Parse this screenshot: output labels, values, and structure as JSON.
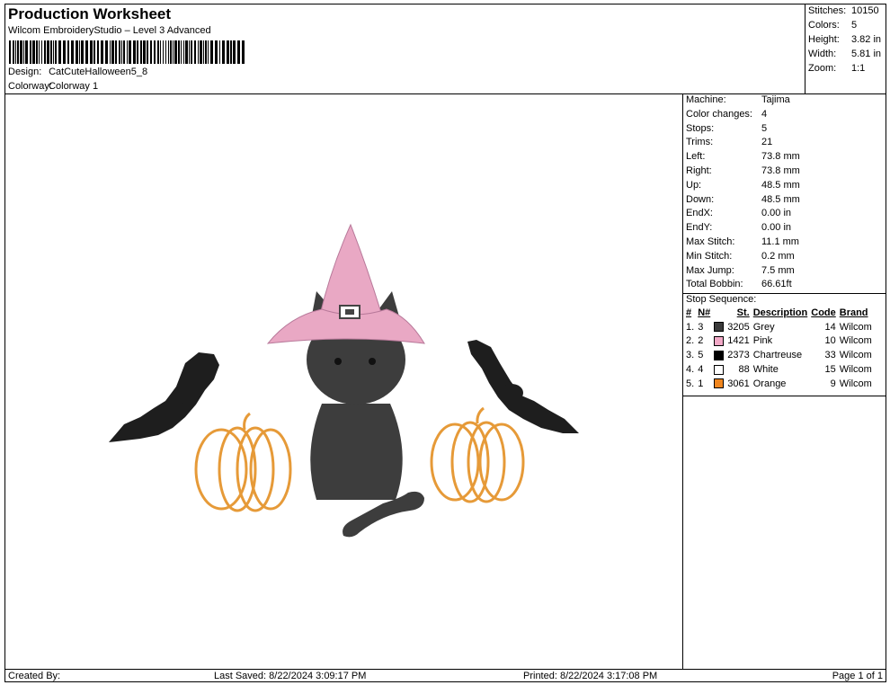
{
  "header": {
    "title": "Production Worksheet",
    "subtitle": "Wilcom EmbroideryStudio – Level 3 Advanced",
    "design_label": "Design:",
    "design_value": "CatCuteHalloween5_8",
    "colorway_label": "Colorway:",
    "colorway_value": "Colorway 1"
  },
  "stats": [
    {
      "label": "Stitches:",
      "value": "10150"
    },
    {
      "label": "Colors:",
      "value": "5"
    },
    {
      "label": "Height:",
      "value": "3.82 in"
    },
    {
      "label": "Width:",
      "value": "5.81 in"
    },
    {
      "label": "Zoom:",
      "value": "1:1"
    }
  ],
  "machine": [
    {
      "label": "Machine:",
      "value": "Tajima"
    },
    {
      "label": "Color changes:",
      "value": "4"
    },
    {
      "label": "Stops:",
      "value": "5"
    },
    {
      "label": "Trims:",
      "value": "21"
    },
    {
      "label": "Left:",
      "value": "73.8 mm"
    },
    {
      "label": "Right:",
      "value": "73.8 mm"
    },
    {
      "label": "Up:",
      "value": "48.5 mm"
    },
    {
      "label": "Down:",
      "value": "48.5 mm"
    },
    {
      "label": "EndX:",
      "value": "0.00 in"
    },
    {
      "label": "EndY:",
      "value": "0.00 in"
    },
    {
      "label": "Max Stitch:",
      "value": "11.1 mm"
    },
    {
      "label": "Min Stitch:",
      "value": "0.2 mm"
    },
    {
      "label": "Max Jump:",
      "value": "7.5 mm"
    },
    {
      "label": "Total Bobbin:",
      "value": "66.61ft"
    }
  ],
  "stop_sequence": {
    "title": "Stop Sequence:",
    "headers": [
      "#",
      "N#",
      "St.",
      "Description",
      "Code",
      "Brand"
    ],
    "rows": [
      {
        "num": "1.",
        "n": "3",
        "color": "#3a3a3a",
        "st": "3205",
        "desc": "Grey",
        "code": "14",
        "brand": "Wilcom"
      },
      {
        "num": "2.",
        "n": "2",
        "color": "#f2a9c7",
        "st": "1421",
        "desc": "Pink",
        "code": "10",
        "brand": "Wilcom"
      },
      {
        "num": "3.",
        "n": "5",
        "color": "#000000",
        "st": "2373",
        "desc": "Chartreuse",
        "code": "33",
        "brand": "Wilcom"
      },
      {
        "num": "4.",
        "n": "4",
        "color": "#ffffff",
        "st": "88",
        "desc": "White",
        "code": "15",
        "brand": "Wilcom"
      },
      {
        "num": "5.",
        "n": "1",
        "color": "#f0861e",
        "st": "3061",
        "desc": "Orange",
        "code": "9",
        "brand": "Wilcom"
      }
    ]
  },
  "footer": {
    "created_by": "Created By:",
    "last_saved": "Last Saved: 8/22/2024 3:09:17 PM",
    "printed": "Printed: 8/22/2024 3:17:08 PM",
    "page": "Page 1 of 1"
  },
  "design_colors": {
    "cat": "#3d3d3d",
    "hat": "#e9a8c4",
    "bat": "#1e1e1e",
    "pumpkin": "#e69a38"
  }
}
